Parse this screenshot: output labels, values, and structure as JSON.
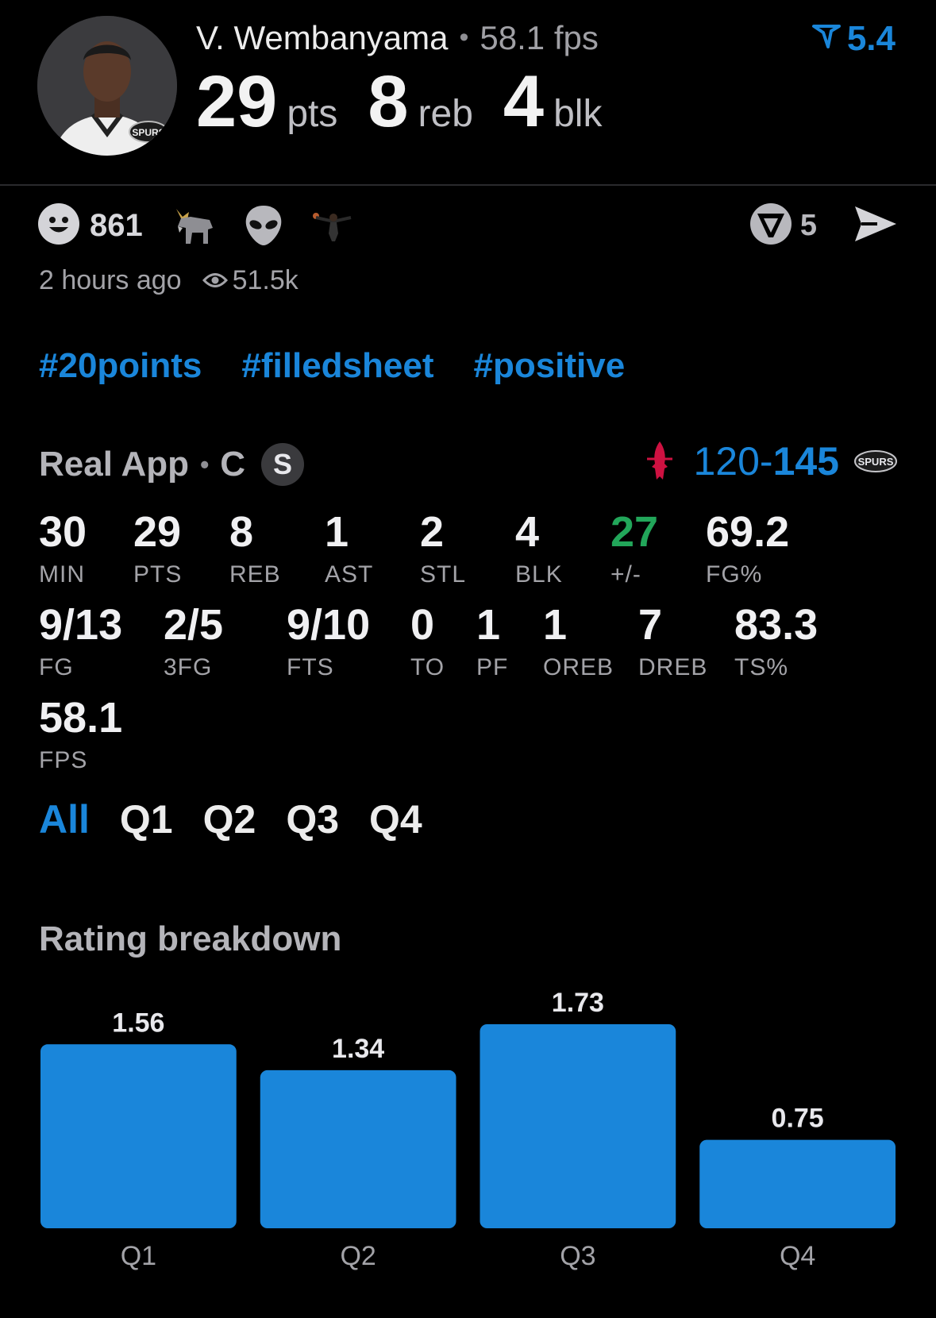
{
  "player": {
    "name": "V. Wembanyama",
    "fps_label": "58.1 fps",
    "rating": "5.4",
    "headline": [
      {
        "value": "29",
        "unit": "pts"
      },
      {
        "value": "8",
        "unit": "reb"
      },
      {
        "value": "4",
        "unit": "blk"
      }
    ],
    "avatar_logo": "SPURS"
  },
  "reactions": {
    "count": "861",
    "emojis": [
      "smiley-icon",
      "goat-icon",
      "alien-icon",
      "dunk-icon"
    ],
    "share_count": "5"
  },
  "meta": {
    "time": "2 hours ago",
    "views": "51.5k"
  },
  "tags": [
    "#20points",
    "#filledsheet",
    "#positive"
  ],
  "game": {
    "source": "Real App",
    "position": "C",
    "badge": "S",
    "score_away": "120",
    "score_sep": "-",
    "score_home": "145",
    "home_logo": "SPURS"
  },
  "stats": {
    "row1": [
      {
        "value": "30",
        "label": "MIN"
      },
      {
        "value": "29",
        "label": "PTS"
      },
      {
        "value": "8",
        "label": "REB"
      },
      {
        "value": "1",
        "label": "AST"
      },
      {
        "value": "2",
        "label": "STL"
      },
      {
        "value": "4",
        "label": "BLK"
      },
      {
        "value": "27",
        "label": "+/-"
      },
      {
        "value": "69.2",
        "label": "FG%"
      }
    ],
    "row2": [
      {
        "value": "9/13",
        "label": "FG"
      },
      {
        "value": "2/5",
        "label": "3FG"
      },
      {
        "value": "9/10",
        "label": "FTS"
      },
      {
        "value": "0",
        "label": "TO"
      },
      {
        "value": "1",
        "label": "PF"
      },
      {
        "value": "1",
        "label": "OREB"
      },
      {
        "value": "7",
        "label": "DREB"
      },
      {
        "value": "83.3",
        "label": "TS%"
      }
    ],
    "row3": [
      {
        "value": "58.1",
        "label": "FPS"
      }
    ]
  },
  "tabs": [
    "All",
    "Q1",
    "Q2",
    "Q3",
    "Q4"
  ],
  "active_tab": "All",
  "section_title": "Rating breakdown",
  "colors": {
    "accent": "#1a86da",
    "positive": "#22a65a",
    "rockets_red": "#ce1141",
    "background": "#000000"
  },
  "chart_data": {
    "type": "bar",
    "categories": [
      "Q1",
      "Q2",
      "Q3",
      "Q4"
    ],
    "values": [
      1.56,
      1.34,
      1.73,
      0.75
    ],
    "labels": [
      "1.56",
      "1.34",
      "1.73",
      "0.75"
    ],
    "ylim": [
      0,
      1.73
    ],
    "grid": false,
    "title": "",
    "xlabel": "",
    "ylabel": ""
  }
}
